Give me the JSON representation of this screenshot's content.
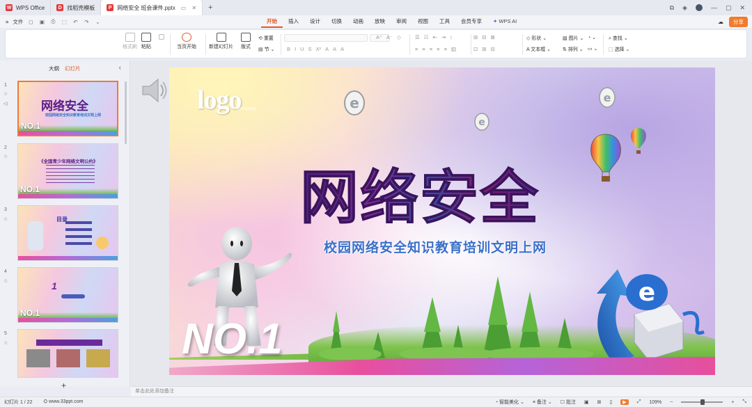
{
  "titlebar": {
    "tabs": [
      {
        "label": "WPS Office",
        "logo": "W",
        "color": "#e4393c"
      },
      {
        "label": "找稻壳模板",
        "logo": "D",
        "color": "#e4393c"
      },
      {
        "label": "网络安全 班会课件.pptx",
        "logo": "P",
        "color": "#e4393c"
      }
    ],
    "new_tab": "+",
    "window_controls": [
      "restore-icon",
      "cube-icon",
      "avatar",
      "minimize-icon",
      "maximize-icon",
      "close-icon"
    ]
  },
  "menubar": {
    "file_label": "文件",
    "ribbon_tabs": [
      "开始",
      "插入",
      "设计",
      "切换",
      "动画",
      "放映",
      "审阅",
      "视图",
      "工具",
      "会员专享"
    ],
    "active_tab": "开始",
    "wps_ai": "WPS AI",
    "share": "分享"
  },
  "toolbar": {
    "format_painter": "格式刷",
    "paste": "粘贴",
    "from_current": "当页开始",
    "new_slide": "新建幻灯片",
    "layout": "版式",
    "reset": "重置",
    "section": "节",
    "shape": "形状",
    "picture": "图片",
    "find": "查找",
    "textbox": "文本框",
    "arrange": "排列",
    "select": "选择"
  },
  "leftpanel": {
    "tabs": [
      "大纲",
      "幻灯片"
    ],
    "active": "幻灯片",
    "add_label": "+",
    "thumbs": [
      {
        "num": "1",
        "title": "网络安全",
        "sub": "校园网络安全知识教育培训文明上网",
        "tag": "NO.1"
      },
      {
        "num": "2",
        "title": "《全国青少年网络文明公约》",
        "sub": "",
        "tag": "NO.1"
      },
      {
        "num": "3",
        "title": "目录",
        "sub": "",
        "tag": ""
      },
      {
        "num": "4",
        "title": "1",
        "sub": "",
        "tag": "NO.1"
      },
      {
        "num": "5",
        "title": "",
        "sub": "",
        "tag": ""
      }
    ]
  },
  "slide": {
    "logo": "logo",
    "logo_sub": "company",
    "title": "网络安全",
    "subtitle": "校园网络安全知识教育培训文明上网",
    "badge": "NO.1"
  },
  "notes": {
    "placeholder": "单击此处添加备注"
  },
  "status": {
    "slide_count": "幻灯片 1 / 22",
    "site": "www.33ppt.com",
    "smart_beautify": "智能美化",
    "notes": "备注",
    "comments": "批注",
    "zoom": "109%"
  }
}
